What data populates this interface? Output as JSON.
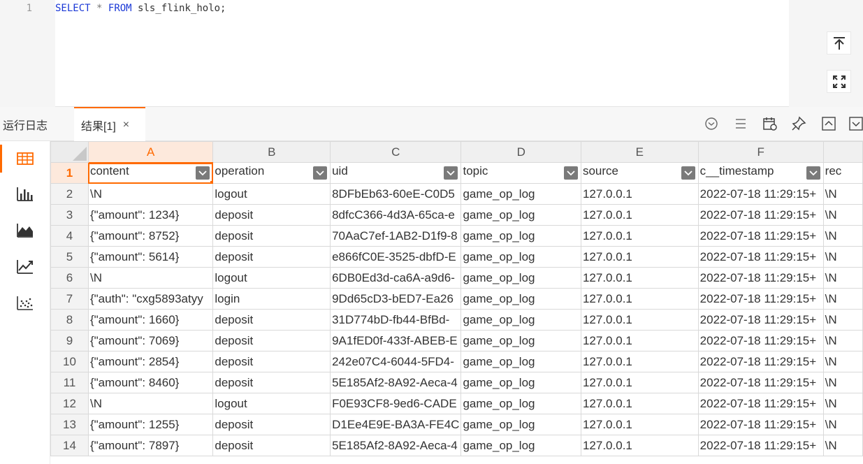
{
  "editor": {
    "line_number": "1",
    "sql_keyword_select": "SELECT",
    "sql_star": "*",
    "sql_keyword_from": "FROM",
    "sql_table": "sls_flink_holo;",
    "buttons": [
      "scroll-to-top-icon",
      "fullscreen-icon"
    ]
  },
  "tabs": {
    "log_label": "运行日志",
    "result_label": "结果[1]",
    "close_glyph": "×"
  },
  "toolbar": {
    "icons": [
      "chevron-down-circle-icon",
      "list-icon",
      "calendar-settings-icon",
      "pin-icon",
      "collapse-up-icon",
      "collapse-down-icon"
    ]
  },
  "sidebar": {
    "items": [
      "table-view-icon",
      "bar-chart-icon",
      "area-chart-icon",
      "line-chart-icon",
      "scatter-chart-icon"
    ],
    "active_index": 0
  },
  "grid": {
    "column_letters": [
      "A",
      "B",
      "C",
      "D",
      "E",
      "F",
      ""
    ],
    "header_row_number": "1",
    "headers": [
      "content",
      "operation",
      "uid",
      "topic",
      "source",
      "c__timestamp",
      "rec"
    ],
    "rows": [
      {
        "n": "2",
        "cells": [
          "\\N",
          "logout",
          "8DFbEb63-60eE-C0D5",
          "game_op_log",
          "127.0.0.1",
          "2022-07-18 11:29:15+",
          "\\N"
        ]
      },
      {
        "n": "3",
        "cells": [
          "{\"amount\": 1234}",
          "deposit",
          "8dfcC366-4d3A-65ca-e",
          "game_op_log",
          "127.0.0.1",
          "2022-07-18 11:29:15+",
          "\\N"
        ]
      },
      {
        "n": "4",
        "cells": [
          "{\"amount\": 8752}",
          "deposit",
          "70AaC7ef-1AB2-D1f9-8",
          "game_op_log",
          "127.0.0.1",
          "2022-07-18 11:29:15+",
          "\\N"
        ]
      },
      {
        "n": "5",
        "cells": [
          "{\"amount\": 5614}",
          "deposit",
          "e866fC0E-3525-dbfD-E",
          "game_op_log",
          "127.0.0.1",
          "2022-07-18 11:29:15+",
          "\\N"
        ]
      },
      {
        "n": "6",
        "cells": [
          "\\N",
          "logout",
          "6DB0Ed3d-ca6A-a9d6-",
          "game_op_log",
          "127.0.0.1",
          "2022-07-18 11:29:15+",
          "\\N"
        ]
      },
      {
        "n": "7",
        "cells": [
          "{\"auth\": \"cxg5893atyy",
          "login",
          "9Dd65cD3-bED7-Ea26",
          "game_op_log",
          "127.0.0.1",
          "2022-07-18 11:29:15+",
          "\\N"
        ]
      },
      {
        "n": "8",
        "cells": [
          "{\"amount\": 1660}",
          "deposit",
          "31D774bD-fb44-BfBd-",
          "game_op_log",
          "127.0.0.1",
          "2022-07-18 11:29:15+",
          "\\N"
        ]
      },
      {
        "n": "9",
        "cells": [
          "{\"amount\": 7069}",
          "deposit",
          "9A1fED0f-433f-ABEB-E",
          "game_op_log",
          "127.0.0.1",
          "2022-07-18 11:29:15+",
          "\\N"
        ]
      },
      {
        "n": "10",
        "cells": [
          "{\"amount\": 2854}",
          "deposit",
          "242e07C4-6044-5FD4-",
          "game_op_log",
          "127.0.0.1",
          "2022-07-18 11:29:15+",
          "\\N"
        ]
      },
      {
        "n": "11",
        "cells": [
          "{\"amount\": 8460}",
          "deposit",
          "5E185Af2-8A92-Aeca-4",
          "game_op_log",
          "127.0.0.1",
          "2022-07-18 11:29:15+",
          "\\N"
        ]
      },
      {
        "n": "12",
        "cells": [
          "\\N",
          "logout",
          "F0E93CF8-9ed6-CADE",
          "game_op_log",
          "127.0.0.1",
          "2022-07-18 11:29:15+",
          "\\N"
        ]
      },
      {
        "n": "13",
        "cells": [
          "{\"amount\": 1255}",
          "deposit",
          "D1Ee4E9E-BA3A-FE4C",
          "game_op_log",
          "127.0.0.1",
          "2022-07-18 11:29:15+",
          "\\N"
        ]
      },
      {
        "n": "14",
        "cells": [
          "{\"amount\": 7897}",
          "deposit",
          "5E185Af2-8A92-Aeca-4",
          "game_op_log",
          "127.0.0.1",
          "2022-07-18 11:29:15+",
          "\\N"
        ]
      }
    ]
  }
}
